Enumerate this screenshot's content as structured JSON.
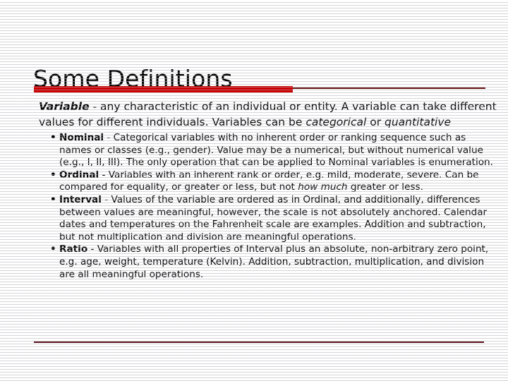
{
  "slide": {
    "title": "Some Definitions",
    "accent_color": "#cc0000",
    "rule_color": "#5e1620",
    "background_color": "#ffffff",
    "text_color": "#000000"
  },
  "lead": {
    "term": "Variable",
    "dash": " - ",
    "text_1": "any characteristic of an individual or entity. A variable can take different values for different individuals. Variables can be ",
    "italic_1": "categorical",
    "text_2": " or ",
    "italic_2": "quantitative"
  },
  "bullets": [
    {
      "marker": "•",
      "name": "Nominal",
      "dash": " - ",
      "text_1": "Categorical variables with no inherent order or ranking   sequence such as names or classes (e.g., gender). Value may be a numerical, but without numerical value (e.g., I, II, III). The only operation that can be applied to Nominal variables is enumeration.",
      "italic_1": "",
      "text_2": ""
    },
    {
      "marker": "•",
      "name": "Ordinal",
      "dash": " - ",
      "text_1": "Variables with an inherent rank or order, e.g. mild, moderate, severe. Can be compared for equality, or greater or less, but not ",
      "italic_1": "how much",
      "text_2": " greater or less."
    },
    {
      "marker": "•",
      "name": "Interval",
      "dash": " - ",
      "text_1": "Values of the variable are ordered as in Ordinal, and additionally, differences between values are meaningful, however, the scale is not absolutely anchored. Calendar dates and temperatures on the Fahrenheit scale are examples. Addition and subtraction, but not multiplication and division are meaningful operations.",
      "italic_1": "",
      "text_2": ""
    },
    {
      "marker": "•",
      "name": "Ratio",
      "dash": " - ",
      "text_1": "Variables with all properties of Interval plus an absolute, non-arbitrary zero point, e.g. age, weight, temperature (Kelvin). Addition, subtraction, multiplication, and division are all meaningful operations.",
      "italic_1": "",
      "text_2": ""
    }
  ]
}
